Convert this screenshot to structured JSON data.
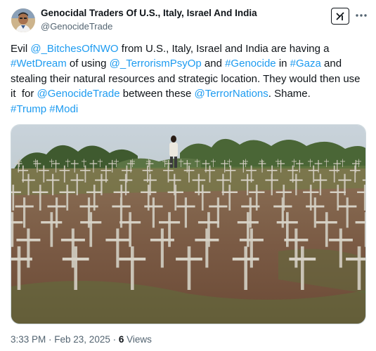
{
  "author": {
    "display_name": "Genocidal Traders Of U.S., Italy, Israel And India",
    "handle": "@GenocideTrade",
    "avatar_icon": "profile-photo"
  },
  "header": {
    "grok_icon": "grok-icon",
    "more_icon": "more-options-icon"
  },
  "tweet": {
    "segments": [
      {
        "text": "Evil ",
        "link": false
      },
      {
        "text": "@_BitchesOfNWO",
        "link": true
      },
      {
        "text": " from U.S., Italy, Israel and India are having a ",
        "link": false
      },
      {
        "text": "#WetDream",
        "link": true
      },
      {
        "text": " of using ",
        "link": false
      },
      {
        "text": "@_TerrorismPsyOp",
        "link": true
      },
      {
        "text": " and ",
        "link": false
      },
      {
        "text": "#Genocide",
        "link": true
      },
      {
        "text": " in ",
        "link": false
      },
      {
        "text": "#Gaza",
        "link": true
      },
      {
        "text": " and stealing their natural resources and strategic location. They would then use it  for ",
        "link": false
      },
      {
        "text": "@GenocideTrade",
        "link": true
      },
      {
        "text": " between these ",
        "link": false
      },
      {
        "text": "@TerrorNations",
        "link": true
      },
      {
        "text": ". Shame.\n",
        "link": false
      },
      {
        "text": "#Trump",
        "link": true
      },
      {
        "text": " ",
        "link": false
      },
      {
        "text": "#Modi",
        "link": true
      }
    ]
  },
  "media": {
    "description_icon": "photo-memorial-crosses"
  },
  "meta": {
    "time": "3:33 PM",
    "separator": " · ",
    "date": "Feb 23, 2025",
    "views_count": "6",
    "views_label": " Views"
  },
  "colors": {
    "link": "#1d9bf0",
    "text": "#0f1419",
    "secondary": "#536471"
  }
}
